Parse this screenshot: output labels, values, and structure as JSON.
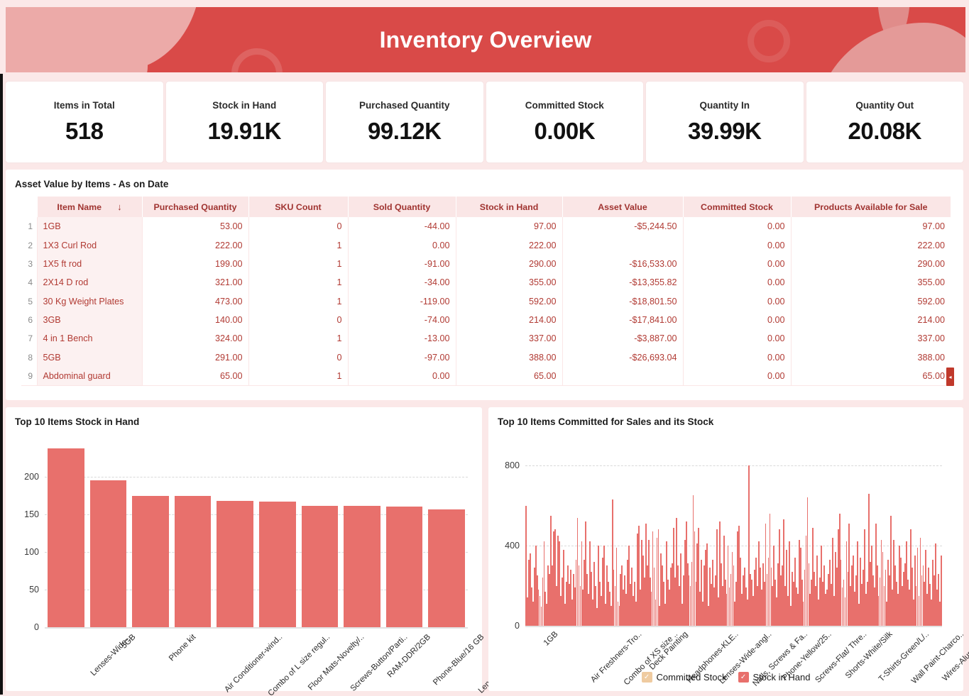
{
  "header": {
    "title": "Inventory Overview"
  },
  "kpis": [
    {
      "label": "Items in Total",
      "value": "518"
    },
    {
      "label": "Stock in Hand",
      "value": "19.91K"
    },
    {
      "label": "Purchased Quantity",
      "value": "99.12K"
    },
    {
      "label": "Committed Stock",
      "value": "0.00K"
    },
    {
      "label": "Quantity In",
      "value": "39.99K"
    },
    {
      "label": "Quantity Out",
      "value": "20.08K"
    }
  ],
  "table": {
    "title": "Asset Value by Items - As on Date",
    "sort_icon": "↓",
    "scroll_icon": "◂",
    "columns": [
      "Item Name",
      "Purchased Quantity",
      "SKU Count",
      "Sold Quantity",
      "Stock in Hand",
      "Asset Value",
      "Committed Stock",
      "Products Available for Sale"
    ],
    "rows": [
      {
        "i": "1",
        "name": "1GB",
        "purchased": "53.00",
        "sku": "0",
        "sold": "-44.00",
        "stock": "97.00",
        "asset": "-$5,244.50",
        "committed": "0.00",
        "available": "97.00"
      },
      {
        "i": "2",
        "name": "1X3 Curl Rod",
        "purchased": "222.00",
        "sku": "1",
        "sold": "0.00",
        "stock": "222.00",
        "asset": "",
        "committed": "0.00",
        "available": "222.00"
      },
      {
        "i": "3",
        "name": "1X5 ft rod",
        "purchased": "199.00",
        "sku": "1",
        "sold": "-91.00",
        "stock": "290.00",
        "asset": "-$16,533.00",
        "committed": "0.00",
        "available": "290.00"
      },
      {
        "i": "4",
        "name": "2X14 D rod",
        "purchased": "321.00",
        "sku": "1",
        "sold": "-34.00",
        "stock": "355.00",
        "asset": "-$13,355.82",
        "committed": "0.00",
        "available": "355.00"
      },
      {
        "i": "5",
        "name": "30 Kg Weight Plates",
        "purchased": "473.00",
        "sku": "1",
        "sold": "-119.00",
        "stock": "592.00",
        "asset": "-$18,801.50",
        "committed": "0.00",
        "available": "592.00"
      },
      {
        "i": "6",
        "name": "3GB",
        "purchased": "140.00",
        "sku": "0",
        "sold": "-74.00",
        "stock": "214.00",
        "asset": "-$17,841.00",
        "committed": "0.00",
        "available": "214.00"
      },
      {
        "i": "7",
        "name": "4 in 1 Bench",
        "purchased": "324.00",
        "sku": "1",
        "sold": "-13.00",
        "stock": "337.00",
        "asset": "-$3,887.00",
        "committed": "0.00",
        "available": "337.00"
      },
      {
        "i": "8",
        "name": "5GB",
        "purchased": "291.00",
        "sku": "0",
        "sold": "-97.00",
        "stock": "388.00",
        "asset": "-$26,693.04",
        "committed": "0.00",
        "available": "388.00"
      },
      {
        "i": "9",
        "name": "Abdominal guard",
        "purchased": "65.00",
        "sku": "1",
        "sold": "0.00",
        "stock": "65.00",
        "asset": "",
        "committed": "0.00",
        "available": "65.00"
      }
    ]
  },
  "colors": {
    "banner_red": "#D94A48",
    "bar_red": "#E8706C",
    "page_bg": "#FBE8E8",
    "table_header_bg": "#FAE6E6",
    "table_text": "#B13A33",
    "legend_committed": "#EFCBA0"
  },
  "chart_data": [
    {
      "type": "bar",
      "title": "Top 10 Items Stock in Hand",
      "xlabel": "",
      "ylabel": "",
      "ylim": [
        0,
        240
      ],
      "yticks": [
        0,
        50,
        100,
        150,
        200
      ],
      "grid": true,
      "legend": "none",
      "categories": [
        "Lenses-Wide-..",
        "5GB",
        "Phone kit",
        "Air Conditioner-wind..",
        "Combo of L size regul..",
        "Floor Mats-Novelty/..",
        "Screws-Button/Parti..",
        "RAM-DDR/2GB",
        "Phone-Blue/16 GB",
        "Lenses-Wide-angle/f.."
      ],
      "values": [
        238,
        196,
        175,
        175,
        168,
        167,
        162,
        162,
        161,
        157
      ]
    },
    {
      "type": "bar",
      "title": "Top 10 Items Committed for Sales and its Stock",
      "xlabel": "",
      "ylabel": "",
      "ylim": [
        0,
        850
      ],
      "yticks": [
        0,
        400,
        800
      ],
      "grid": true,
      "legend_position": "bottom",
      "legend_entries": [
        "Committed Stock",
        "Stock in Hand"
      ],
      "categories": [
        "1GB",
        "Air Freshners-Tro..",
        "Combo of XS size ..",
        "Deck Painting",
        "Headphones-KLE..",
        "Lenses-Wide-angl..",
        "Nails, Screws & Fa..",
        "Phone-Yellow/25..",
        "Screws-Flat/ Thre..",
        "Shorts-White/Silk",
        "T-Shirts-Green/L/..",
        "Wall Paint-Charco..",
        "Wires-Aluminium.."
      ],
      "series": [
        {
          "name": "Committed Stock",
          "values": []
        },
        {
          "name": "Stock in Hand",
          "values": [
            600,
            140,
            330,
            360,
            190,
            120,
            290,
            400,
            250,
            180,
            150,
            95,
            240,
            420,
            170,
            110,
            300,
            260,
            550,
            300,
            470,
            480,
            200,
            450,
            420,
            150,
            240,
            380,
            110,
            220,
            300,
            210,
            280,
            130,
            260,
            190,
            330,
            540,
            300,
            200,
            420,
            180,
            330,
            520,
            260,
            160,
            420,
            270,
            130,
            320,
            200,
            90,
            400,
            220,
            150,
            340,
            400,
            110,
            300,
            220,
            170,
            100,
            630,
            280,
            200,
            390,
            120,
            100,
            260,
            300,
            180,
            250,
            160,
            330,
            400,
            210,
            290,
            150,
            220,
            120,
            460,
            500,
            180,
            430,
            350,
            240,
            510,
            300,
            430,
            240,
            170,
            470,
            290,
            130,
            440,
            480,
            100,
            360,
            300,
            220,
            110,
            420,
            230,
            180,
            290,
            310,
            490,
            240,
            540,
            300,
            200,
            360,
            110,
            250,
            430,
            520,
            310,
            250,
            200,
            320,
            650,
            470,
            220,
            410,
            490,
            170,
            330,
            120,
            300,
            380,
            410,
            100,
            290,
            210,
            330,
            190,
            250,
            480,
            140,
            520,
            310,
            200,
            450,
            230,
            160,
            400,
            190,
            260,
            370,
            300,
            120,
            220,
            470,
            500,
            340,
            160,
            250,
            290,
            190,
            130,
            800,
            260,
            230,
            150,
            280,
            340,
            200,
            420,
            290,
            180,
            310,
            220,
            510,
            260,
            340,
            560,
            290,
            200,
            400,
            230,
            140,
            310,
            480,
            250,
            300,
            530,
            200,
            380,
            150,
            420,
            100,
            270,
            220,
            340,
            190,
            160,
            430,
            390,
            230,
            120,
            280,
            450,
            640,
            310,
            160,
            230,
            490,
            270,
            200,
            350,
            130,
            240,
            400,
            220,
            300,
            160,
            180,
            260,
            330,
            210,
            440,
            150,
            370,
            290,
            480,
            560,
            330,
            190,
            230,
            140,
            420,
            270,
            510,
            200,
            300,
            350,
            170,
            250,
            420,
            110,
            340,
            210,
            280,
            480,
            160,
            220,
            660,
            320,
            400,
            250,
            190,
            510,
            300,
            150,
            240,
            430,
            370,
            200,
            280,
            120,
            330,
            250,
            550,
            180,
            430,
            300,
            220,
            160,
            400,
            340,
            200,
            270,
            310,
            420,
            230,
            180,
            480,
            290,
            130,
            350,
            200,
            390,
            150,
            440,
            250,
            300,
            220,
            380,
            160,
            290,
            210,
            130,
            330,
            250,
            410,
            180,
            260,
            120,
            350
          ]
        }
      ]
    }
  ]
}
